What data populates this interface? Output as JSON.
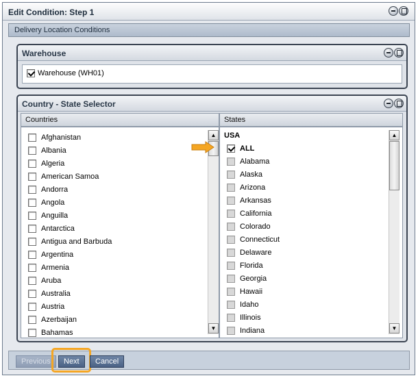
{
  "window": {
    "title": "Edit Condition: Step 1"
  },
  "section_bar": {
    "label": "Delivery Location Conditions"
  },
  "warehouse_panel": {
    "title": "Warehouse",
    "items": [
      {
        "label": "Warehouse (WH01)",
        "checked": true
      }
    ]
  },
  "selector_panel": {
    "title": "Country - State Selector",
    "countries_header": "Countries",
    "states_header": "States",
    "countries": [
      "Afghanistan",
      "Albania",
      "Algeria",
      "American Samoa",
      "Andorra",
      "Angola",
      "Anguilla",
      "Antarctica",
      "Antigua and Barbuda",
      "Argentina",
      "Armenia",
      "Aruba",
      "Australia",
      "Austria",
      "Azerbaijan",
      "Bahamas"
    ],
    "states_country": "USA",
    "all_label": "ALL",
    "all_checked": true,
    "states": [
      "Alabama",
      "Alaska",
      "Arizona",
      "Arkansas",
      "California",
      "Colorado",
      "Connecticut",
      "Delaware",
      "Florida",
      "Georgia",
      "Hawaii",
      "Idaho",
      "Illinois",
      "Indiana"
    ]
  },
  "footer": {
    "previous_label": "Previous",
    "next_label": "Next",
    "cancel_label": "Cancel"
  },
  "colors": {
    "highlight": "#f5a623",
    "button": "#4a6185"
  }
}
